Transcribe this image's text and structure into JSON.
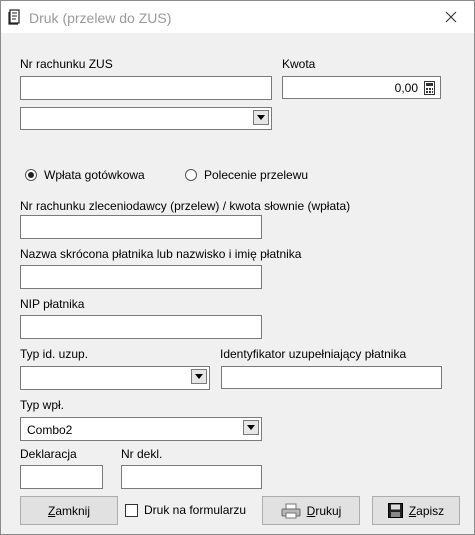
{
  "window": {
    "title": "Druk (przelew do ZUS)"
  },
  "labels": {
    "nr_rachunku_zus": "Nr rachunku ZUS",
    "kwota": "Kwota",
    "nr_rachunku_zleceniodawcy": "Nr rachunku zleceniodawcy (przelew) / kwota słownie (wpłata)",
    "nazwa_platnika": "Nazwa skrócona płatnika lub nazwisko i imię płatnika",
    "nip_platnika": "NIP płatnika",
    "typ_id_uzup": "Typ id. uzup.",
    "identyfikator_uzup": "Identyfikator uzupełniający płatnika",
    "typ_wpl": "Typ wpł.",
    "deklaracja": "Deklaracja",
    "nr_dekl": "Nr dekl."
  },
  "fields": {
    "kwota_value": "0,00",
    "typ_wpl_value": "Combo2"
  },
  "radios": {
    "wplata_gotowkowa": "Wpłata gotówkowa",
    "polecenie_przelewu": "Polecenie przelewu",
    "selected": "wplata_gotowkowa"
  },
  "buttons": {
    "zamknij_u": "Z",
    "zamknij_rest": "amknij",
    "drukuj_u": "D",
    "drukuj_rest": "rukuj",
    "zapisz_u": "Z",
    "zapisz_rest": "apisz"
  },
  "checkbox": {
    "druk_na_formularzu": "Druk na formularzu",
    "checked": false
  }
}
